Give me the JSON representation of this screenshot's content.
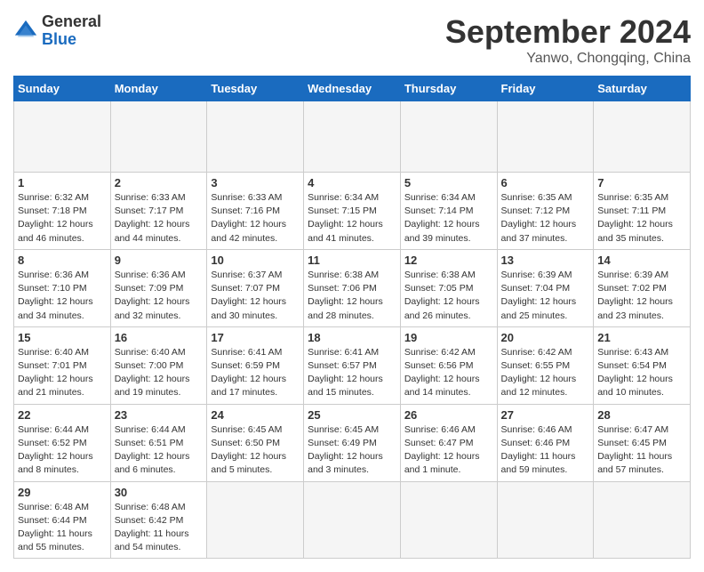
{
  "header": {
    "logo_general": "General",
    "logo_blue": "Blue",
    "month_title": "September 2024",
    "location": "Yanwo, Chongqing, China"
  },
  "calendar": {
    "days_of_week": [
      "Sunday",
      "Monday",
      "Tuesday",
      "Wednesday",
      "Thursday",
      "Friday",
      "Saturday"
    ],
    "weeks": [
      [
        {
          "day": "",
          "data": ""
        },
        {
          "day": "",
          "data": ""
        },
        {
          "day": "",
          "data": ""
        },
        {
          "day": "",
          "data": ""
        },
        {
          "day": "",
          "data": ""
        },
        {
          "day": "",
          "data": ""
        },
        {
          "day": "",
          "data": ""
        }
      ],
      [
        {
          "day": "1",
          "data": "Sunrise: 6:32 AM\nSunset: 7:18 PM\nDaylight: 12 hours and 46 minutes."
        },
        {
          "day": "2",
          "data": "Sunrise: 6:33 AM\nSunset: 7:17 PM\nDaylight: 12 hours and 44 minutes."
        },
        {
          "day": "3",
          "data": "Sunrise: 6:33 AM\nSunset: 7:16 PM\nDaylight: 12 hours and 42 minutes."
        },
        {
          "day": "4",
          "data": "Sunrise: 6:34 AM\nSunset: 7:15 PM\nDaylight: 12 hours and 41 minutes."
        },
        {
          "day": "5",
          "data": "Sunrise: 6:34 AM\nSunset: 7:14 PM\nDaylight: 12 hours and 39 minutes."
        },
        {
          "day": "6",
          "data": "Sunrise: 6:35 AM\nSunset: 7:12 PM\nDaylight: 12 hours and 37 minutes."
        },
        {
          "day": "7",
          "data": "Sunrise: 6:35 AM\nSunset: 7:11 PM\nDaylight: 12 hours and 35 minutes."
        }
      ],
      [
        {
          "day": "8",
          "data": "Sunrise: 6:36 AM\nSunset: 7:10 PM\nDaylight: 12 hours and 34 minutes."
        },
        {
          "day": "9",
          "data": "Sunrise: 6:36 AM\nSunset: 7:09 PM\nDaylight: 12 hours and 32 minutes."
        },
        {
          "day": "10",
          "data": "Sunrise: 6:37 AM\nSunset: 7:07 PM\nDaylight: 12 hours and 30 minutes."
        },
        {
          "day": "11",
          "data": "Sunrise: 6:38 AM\nSunset: 7:06 PM\nDaylight: 12 hours and 28 minutes."
        },
        {
          "day": "12",
          "data": "Sunrise: 6:38 AM\nSunset: 7:05 PM\nDaylight: 12 hours and 26 minutes."
        },
        {
          "day": "13",
          "data": "Sunrise: 6:39 AM\nSunset: 7:04 PM\nDaylight: 12 hours and 25 minutes."
        },
        {
          "day": "14",
          "data": "Sunrise: 6:39 AM\nSunset: 7:02 PM\nDaylight: 12 hours and 23 minutes."
        }
      ],
      [
        {
          "day": "15",
          "data": "Sunrise: 6:40 AM\nSunset: 7:01 PM\nDaylight: 12 hours and 21 minutes."
        },
        {
          "day": "16",
          "data": "Sunrise: 6:40 AM\nSunset: 7:00 PM\nDaylight: 12 hours and 19 minutes."
        },
        {
          "day": "17",
          "data": "Sunrise: 6:41 AM\nSunset: 6:59 PM\nDaylight: 12 hours and 17 minutes."
        },
        {
          "day": "18",
          "data": "Sunrise: 6:41 AM\nSunset: 6:57 PM\nDaylight: 12 hours and 15 minutes."
        },
        {
          "day": "19",
          "data": "Sunrise: 6:42 AM\nSunset: 6:56 PM\nDaylight: 12 hours and 14 minutes."
        },
        {
          "day": "20",
          "data": "Sunrise: 6:42 AM\nSunset: 6:55 PM\nDaylight: 12 hours and 12 minutes."
        },
        {
          "day": "21",
          "data": "Sunrise: 6:43 AM\nSunset: 6:54 PM\nDaylight: 12 hours and 10 minutes."
        }
      ],
      [
        {
          "day": "22",
          "data": "Sunrise: 6:44 AM\nSunset: 6:52 PM\nDaylight: 12 hours and 8 minutes."
        },
        {
          "day": "23",
          "data": "Sunrise: 6:44 AM\nSunset: 6:51 PM\nDaylight: 12 hours and 6 minutes."
        },
        {
          "day": "24",
          "data": "Sunrise: 6:45 AM\nSunset: 6:50 PM\nDaylight: 12 hours and 5 minutes."
        },
        {
          "day": "25",
          "data": "Sunrise: 6:45 AM\nSunset: 6:49 PM\nDaylight: 12 hours and 3 minutes."
        },
        {
          "day": "26",
          "data": "Sunrise: 6:46 AM\nSunset: 6:47 PM\nDaylight: 12 hours and 1 minute."
        },
        {
          "day": "27",
          "data": "Sunrise: 6:46 AM\nSunset: 6:46 PM\nDaylight: 11 hours and 59 minutes."
        },
        {
          "day": "28",
          "data": "Sunrise: 6:47 AM\nSunset: 6:45 PM\nDaylight: 11 hours and 57 minutes."
        }
      ],
      [
        {
          "day": "29",
          "data": "Sunrise: 6:48 AM\nSunset: 6:44 PM\nDaylight: 11 hours and 55 minutes."
        },
        {
          "day": "30",
          "data": "Sunrise: 6:48 AM\nSunset: 6:42 PM\nDaylight: 11 hours and 54 minutes."
        },
        {
          "day": "",
          "data": ""
        },
        {
          "day": "",
          "data": ""
        },
        {
          "day": "",
          "data": ""
        },
        {
          "day": "",
          "data": ""
        },
        {
          "day": "",
          "data": ""
        }
      ]
    ]
  }
}
